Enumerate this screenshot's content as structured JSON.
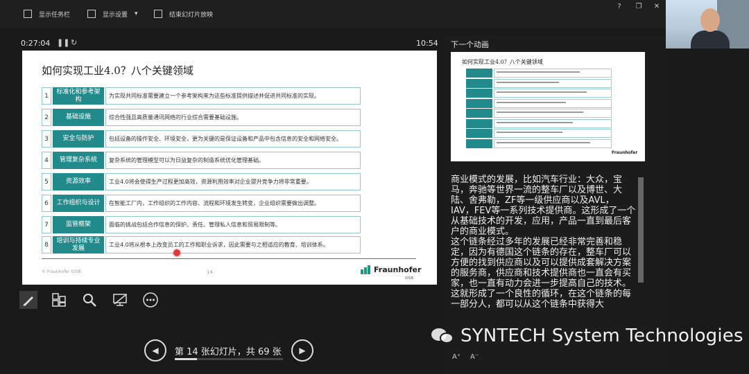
{
  "toolbar": {
    "show_taskbar": "显示任务栏",
    "display_settings": "显示设置",
    "end_slideshow": "结束幻灯片放映",
    "window_controls": [
      "?",
      "–",
      "❐",
      "✕"
    ]
  },
  "presenter": {
    "elapsed": "0:27:04",
    "clock": "10:54",
    "pause_icon": "pause-icon",
    "restart_icon": "restart-icon"
  },
  "slide": {
    "title": "如何实现工业4.0？八个关键领域",
    "rows": [
      {
        "num": "1",
        "category": "标准化和参考架构",
        "desc": "为实现共同标准需要建立一个参考架构来为这些标准提供描述并促进共同标准的实现。"
      },
      {
        "num": "2",
        "category": "基础设施",
        "desc": "综合性强且高质量通讯网络的行业综合需要基础设施。"
      },
      {
        "num": "3",
        "category": "安全与防护",
        "desc": "包括设备的操作安全、环境安全，更为关键的是保证设备和产品中包含信息的安全和网络安全。"
      },
      {
        "num": "4",
        "category": "管理复杂系统",
        "desc": "复杂系统的管理模型可以为日益复杂的制造系统优化管理基础。"
      },
      {
        "num": "5",
        "category": "资源效率",
        "desc": "工业4.0将会使得生产过程更加高效，资源利用效率对企业提升竞争力将非常重要。"
      },
      {
        "num": "6",
        "category": "工作组织与设计",
        "desc": "在智能工厂内，工作组织的工作内容、流程和环境发生转变，企业组织需要做出调整。"
      },
      {
        "num": "7",
        "category": "监管框架",
        "desc": "面临的挑战包括合作信息的保护、责任、管理私人信息和贸易限制等。"
      },
      {
        "num": "8",
        "category": "培训与持续专业发展",
        "desc": "工业4.0将从根本上改变员工的工作和职业诉求，因此需要与之相适应的教育、培训体系。"
      }
    ],
    "footer_left": "© Fraunhofer IOSB",
    "page_number": "14",
    "logo_name": "Fraunhofer",
    "logo_sub": "IOSB"
  },
  "tools": [
    "pen-icon",
    "slides-grid-icon",
    "zoom-icon",
    "screen-icon",
    "more-icon"
  ],
  "navigation": {
    "counter": "第 14 张幻灯片，共 69 张",
    "current": 14,
    "total": 69,
    "prev_icon": "chevron-left-icon",
    "next_icon": "chevron-right-icon"
  },
  "next_panel": {
    "label": "下一个动画",
    "thumb_title": "如何实现工业4.0？八个关键领域",
    "thumb_logo": "Fraunhofer"
  },
  "notes": {
    "paragraphs": [
      "商业模式的发展，比如汽车行业：大众，宝马，奔驰等世界一流的整车厂以及博世、大陆、舍弗勒，ZF等一级供应商以及AVL，IAV，FEV等一系列技术提供商。这形成了一个从基础技术的开发，应用，产品一直到最后客户的商业模式。",
      "这个链条经过多年的发展已经非常完善和稳定，因为有德国这个链条的存在，整车厂可以方便的找到供应商以及可以提供成套解决方案的服务商，供应商和技术提供商也一直会有买家，也一直有动力会进一步提高自己的技术。",
      "这就形成了一个良性的循环，在这个链条的每一部分人，都可以从这个链条中获得大"
    ],
    "zoom_in": "A⁺",
    "zoom_out": "A⁻"
  },
  "watermark": {
    "text": "SYNTECH System Technologies",
    "icon": "wechat-icon"
  }
}
